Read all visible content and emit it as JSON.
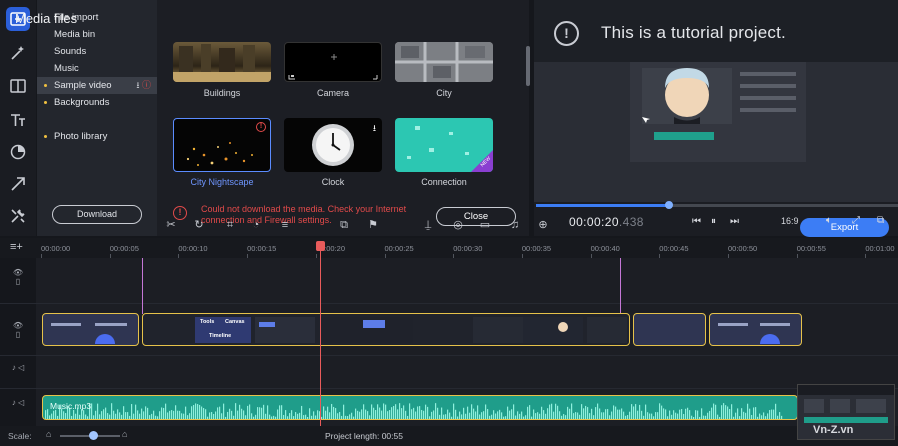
{
  "sidebar": {
    "items": [
      {
        "label": "File import",
        "dot": false
      },
      {
        "label": "Media bin",
        "dot": false
      },
      {
        "label": "Sounds",
        "dot": false
      },
      {
        "label": "Music",
        "dot": false
      },
      {
        "label": "Sample video",
        "dot": true
      },
      {
        "label": "Backgrounds",
        "dot": true
      },
      {
        "label": "Photo library",
        "dot": true
      }
    ],
    "download_label": "Download"
  },
  "media": {
    "title": "Media files",
    "thumbnails": [
      {
        "label": "Buildings"
      },
      {
        "label": "Camera"
      },
      {
        "label": "City"
      },
      {
        "label": "City Nightscape"
      },
      {
        "label": "Clock"
      },
      {
        "label": "Connection",
        "badge": "NEW"
      }
    ]
  },
  "error": {
    "message": "Could not download the media. Check your Internet connection and Firewall settings.",
    "close_label": "Close"
  },
  "preview": {
    "banner_text": "This is a tutorial project.",
    "timecode": "00:00:20",
    "timecode_ms": ".438",
    "aspect_ratio": "16:9",
    "export_label": "Export",
    "progress": 0.37
  },
  "timeline": {
    "ruler_labels": [
      "00:00:00",
      "00:00:05",
      "00:00:10",
      "00:00:15",
      "00:00:20",
      "00:00:25",
      "00:00:30",
      "00:00:35",
      "00:00:40",
      "00:00:45",
      "00:00:50",
      "00:00:55",
      "00:01:00"
    ],
    "clip_labels": [
      "Tools",
      "Canvas",
      "Timeline"
    ],
    "audio_label": "Music.mp3"
  },
  "status": {
    "scale_label": "Scale:",
    "project_length": "Project length:  00:55"
  },
  "watermark": "Vn-Z.vn",
  "colors": {
    "accent": "#3c7df5",
    "clip_border": "#e6c24a",
    "audio": "#1f9d8a",
    "error": "#e14a4a",
    "playhead": "#e85b5b"
  }
}
